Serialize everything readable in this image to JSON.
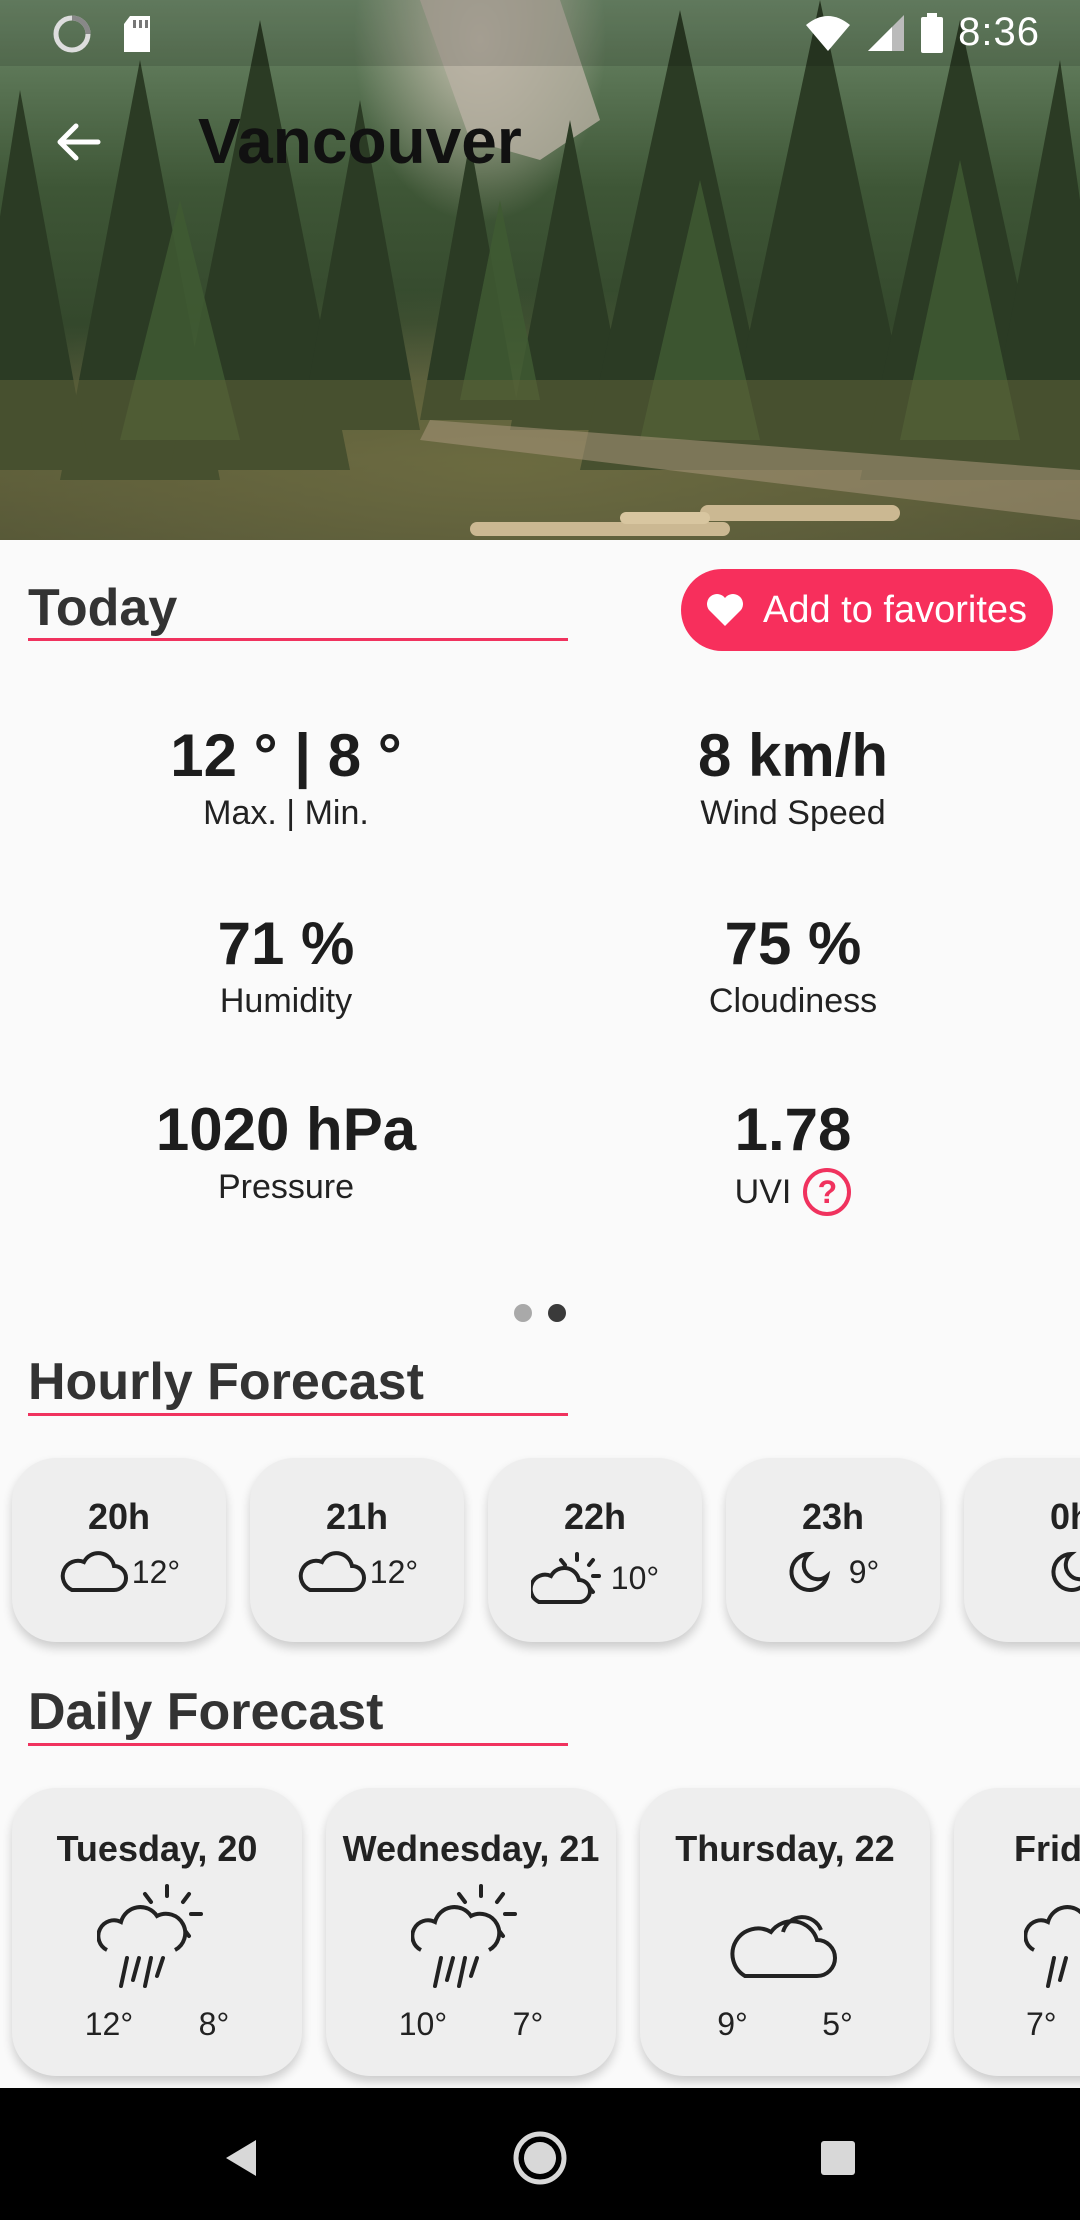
{
  "status_bar": {
    "time": "8:36",
    "left_icons": [
      "spinner-icon",
      "sd-card-icon"
    ],
    "right_icons": [
      "wifi-icon",
      "signal-icon",
      "battery-icon"
    ]
  },
  "toolbar": {
    "back_icon": "arrow-left-icon",
    "city": "Vancouver"
  },
  "today": {
    "title": "Today",
    "favorite_button": "Add to favorites",
    "favorite_icon": "heart-icon",
    "stats": {
      "maxmin": {
        "value": "12 ° |  8 °",
        "label": "Max. | Min."
      },
      "wind": {
        "value": "8 km/h",
        "label": "Wind Speed"
      },
      "humidity": {
        "value": "71 %",
        "label": "Humidity"
      },
      "cloudiness": {
        "value": "75 %",
        "label": "Cloudiness"
      },
      "pressure": {
        "value": "1020 hPa",
        "label": "Pressure"
      },
      "uvi": {
        "value": "1.78",
        "label": "UVI",
        "help": "?"
      }
    },
    "pager": {
      "pages": 2,
      "active": 2
    }
  },
  "hourly": {
    "title": "Hourly Forecast",
    "items": [
      {
        "hour": "20h",
        "temp": "12°",
        "icon": "cloud-icon"
      },
      {
        "hour": "21h",
        "temp": "12°",
        "icon": "cloud-icon"
      },
      {
        "hour": "22h",
        "temp": "10°",
        "icon": "partly-sunny-icon"
      },
      {
        "hour": "23h",
        "temp": "9°",
        "icon": "moon-icon"
      },
      {
        "hour": "0h",
        "temp": "",
        "icon": "moon-icon"
      }
    ]
  },
  "daily": {
    "title": "Daily Forecast",
    "items": [
      {
        "day": "Tuesday, 20",
        "max": "12°",
        "min": "8°",
        "icon": "sun-rain-cloud-icon"
      },
      {
        "day": "Wednesday, 21",
        "max": "10°",
        "min": "7°",
        "icon": "sun-rain-cloud-icon"
      },
      {
        "day": "Thursday, 22",
        "max": "9°",
        "min": "5°",
        "icon": "cloud-icon"
      },
      {
        "day": "Frid",
        "max": "7°",
        "min": "",
        "icon": "sun-rain-cloud-icon"
      }
    ]
  },
  "colors": {
    "accent": "#f72f5c",
    "underline": "#f0325e",
    "card": "#eeeeee",
    "background": "#fafafa"
  },
  "nav_bar": {
    "icons": [
      "back-triangle-icon",
      "home-circle-icon",
      "recents-square-icon"
    ]
  }
}
